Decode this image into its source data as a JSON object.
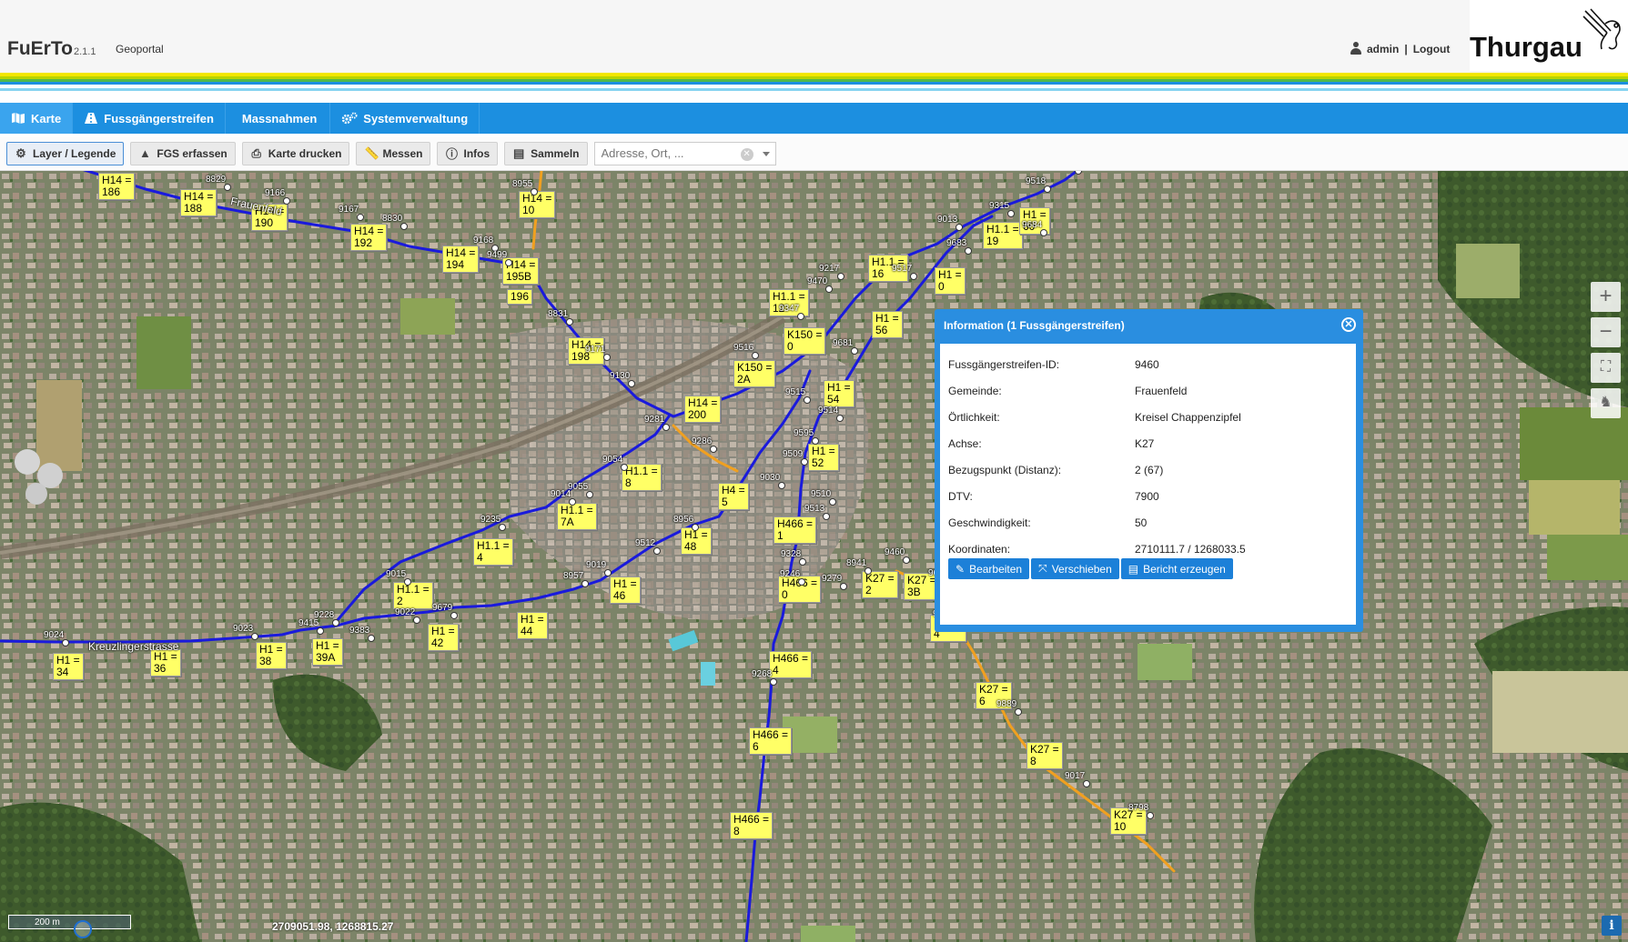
{
  "header": {
    "app_name": "FuErTo",
    "version": "2.1.1",
    "geoportal": "Geoportal",
    "user": "admin",
    "separator": "|",
    "logout": "Logout",
    "logo_text": "Thurgau"
  },
  "nav": {
    "tabs": [
      {
        "label": "Karte",
        "icon": "map-icon",
        "active": true
      },
      {
        "label": "Fussgängerstreifen",
        "icon": "crosswalk-icon",
        "active": false
      },
      {
        "label": "Massnahmen",
        "icon": "",
        "active": false
      },
      {
        "label": "Systemverwaltung",
        "icon": "gears-icon",
        "active": false
      }
    ]
  },
  "toolbar": {
    "layer": "Layer / Legende",
    "fgs": "FGS erfassen",
    "print": "Karte drucken",
    "measure": "Messen",
    "info": "Infos",
    "collect": "Sammeln",
    "search_placeholder": "Adresse, Ort, ..."
  },
  "map": {
    "scale_label": "200 m",
    "coordinates": "2709051.98, 1268815.27",
    "road_colors": {
      "hauptstrasse": "#1a1adc",
      "kantonsstrasse": "#f0a020"
    },
    "labels": [
      "H14 =\n186",
      "H14 =\n188",
      "H14 =\n190",
      "H14 =\n192",
      "H14 =\n194",
      "H14 =\n195B",
      "196",
      "H14 =\n198",
      "H14 =\n200",
      "K150 =\n0",
      "K150 =\n2A",
      "H1.1 =\n16",
      "H1.1 =\n19",
      "H1 =\n56",
      "H1 =\n54",
      "H1 =\n52",
      "H1.1 =\n8",
      "H1.1 =\n7A",
      "H1.1 =\n4",
      "H1.1 =\n2",
      "H1 =\n48",
      "H1 =\n46",
      "H1 =\n44",
      "H1 =\n42",
      "H1 =\n39A",
      "H1 =\n38",
      "H1 =\n36",
      "H1 =\n34",
      "H466 =\n0",
      "H466 =\n1",
      "H466 =\n4",
      "H466 =\n6",
      "H466 =\n8",
      "K27 =\n2",
      "K27 =\n3B",
      "K27 =\n4",
      "K27 =\n6",
      "K27 =\n8",
      "K27 =\n10",
      "H14 =\n10",
      "H1 =\n60",
      "H1.1 =\n12",
      "H4 =\n5",
      "H1 =\n0"
    ],
    "numbers": [
      "8829",
      "9166",
      "9167",
      "8830",
      "9168",
      "9499",
      "8955",
      "8831",
      "9171",
      "9130",
      "9281",
      "9286",
      "9054",
      "9055",
      "9014",
      "9235",
      "9015",
      "9228",
      "9415",
      "9383",
      "9022",
      "9679",
      "9023",
      "9024",
      "9019",
      "8957",
      "9512",
      "8956",
      "9217",
      "9470",
      "9347",
      "9516",
      "9515",
      "9514",
      "9595",
      "9509",
      "9030",
      "9510",
      "9513",
      "9328",
      "8941",
      "9246",
      "9279",
      "9460",
      "9693",
      "9036",
      "9889",
      "9017",
      "8798",
      "9268",
      "9013",
      "9315",
      "9684",
      "9683",
      "9517",
      "9681",
      "9518",
      "85"
    ],
    "street_names": [
      "Kreuzlingerstrasse",
      "Frauenfeld"
    ]
  },
  "popup": {
    "title": "Information (1 Fussgängerstreifen)",
    "fields": [
      {
        "label": "Fussgängerstreifen-ID:",
        "value": "9460"
      },
      {
        "label": "Gemeinde:",
        "value": "Frauenfeld"
      },
      {
        "label": "Örtlichkeit:",
        "value": "Kreisel Chappenzipfel"
      },
      {
        "label": "Achse:",
        "value": "K27"
      },
      {
        "label": "Bezugspunkt (Distanz):",
        "value": "2 (67)"
      },
      {
        "label": "DTV:",
        "value": "7900"
      },
      {
        "label": "Geschwindigkeit:",
        "value": "50"
      },
      {
        "label": "Koordinaten:",
        "value": "2710111.7 / 1268033.5"
      }
    ],
    "buttons": {
      "edit": "Bearbeiten",
      "move": "Verschieben",
      "report": "Bericht erzeugen"
    }
  },
  "controls": {
    "info": "i"
  }
}
